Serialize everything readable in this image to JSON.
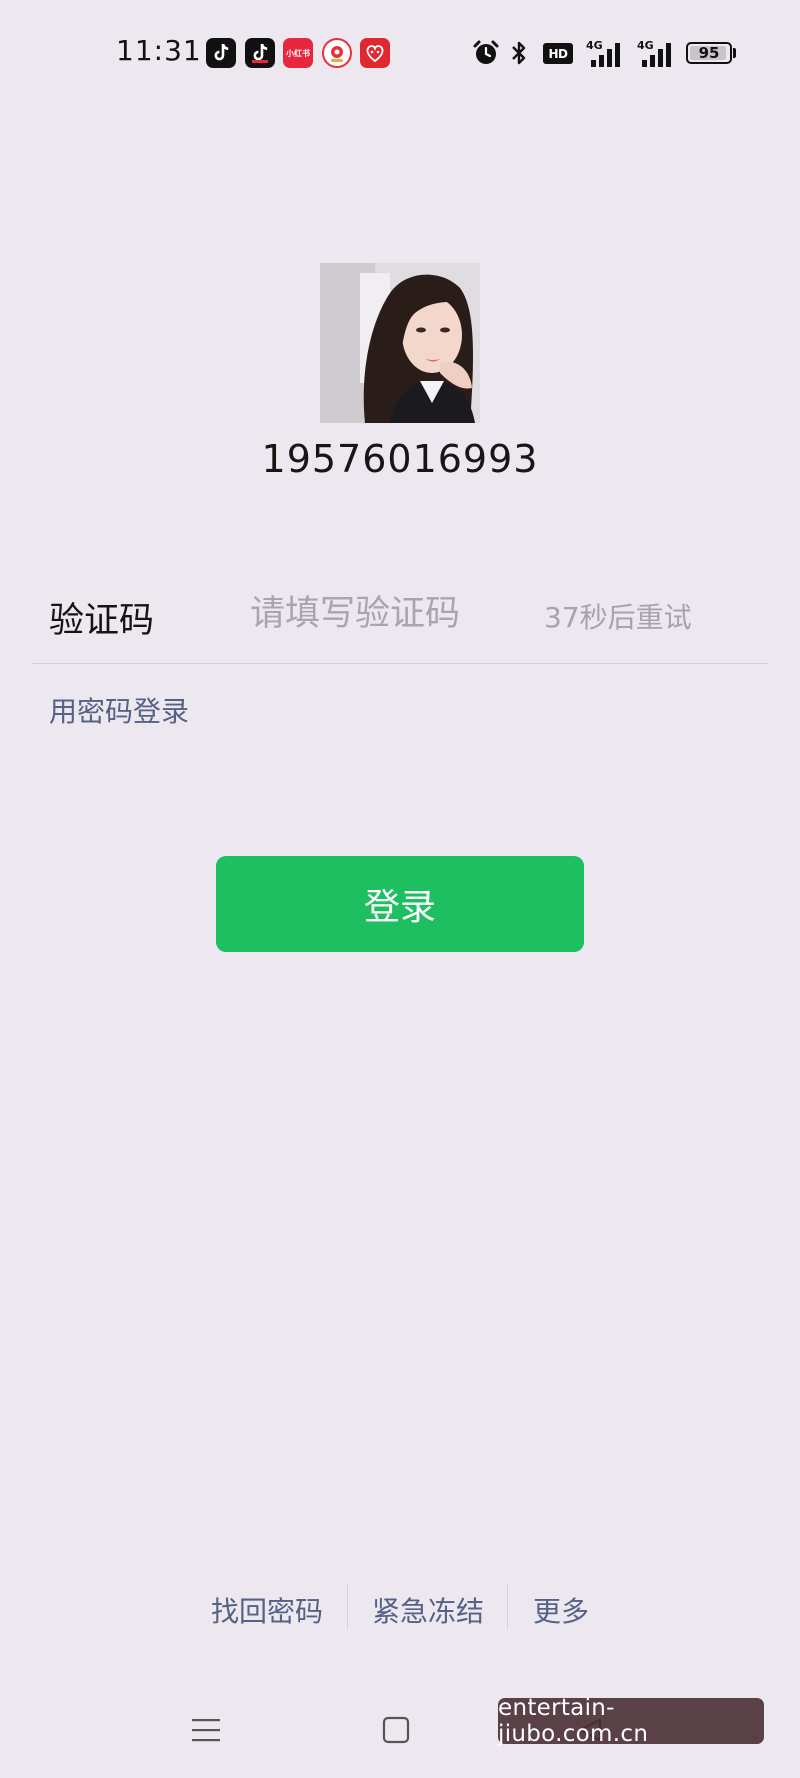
{
  "status_bar": {
    "time": "11:31",
    "app_icons": [
      "tiktok-icon",
      "tiktok-lite-icon",
      "xiaohongshu-icon",
      "red-app-icon",
      "pinduoduo-icon"
    ],
    "xhs_label": "小红书",
    "system_icons": [
      "alarm-icon",
      "bluetooth-icon",
      "hd-icon",
      "signal-4g-icon",
      "signal-4g-icon"
    ],
    "hd_label": "HD",
    "signal_label": "4G",
    "battery_level": "95"
  },
  "account": {
    "avatar": "profile-photo",
    "id": "19576016993"
  },
  "code_row": {
    "label": "验证码",
    "placeholder": "请填写验证码",
    "value": "",
    "resend_timer": "37秒后重试"
  },
  "password_login": "用密码登录",
  "login_button": "登录",
  "bottom_links": {
    "recover": "找回密码",
    "freeze": "紧急冻结",
    "more": "更多"
  },
  "nav": [
    "menu-icon",
    "home-icon",
    "back-icon"
  ],
  "watermark": "entertain-jiubo.com.cn",
  "colors": {
    "background": "#ede8ef",
    "primary": "#1dbf61",
    "link": "#556185",
    "muted": "#a7a3ab"
  }
}
